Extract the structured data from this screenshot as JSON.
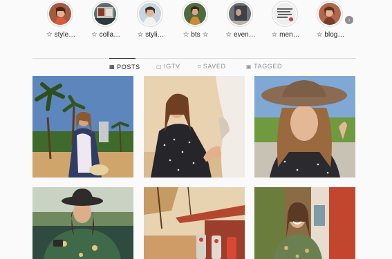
{
  "highlights": [
    {
      "label": "☆ style…",
      "icon": "highlight-style-thumbnail"
    },
    {
      "label": "☆ colla…",
      "icon": "highlight-collab-thumbnail"
    },
    {
      "label": "☆ styli…",
      "icon": "highlight-styling-thumbnail"
    },
    {
      "label": "☆ bts ☆",
      "icon": "highlight-bts-thumbnail"
    },
    {
      "label": "☆ even…",
      "icon": "highlight-events-thumbnail"
    },
    {
      "label": "☆ men…",
      "icon": "highlight-mentions-thumbnail"
    },
    {
      "label": "☆ blog…",
      "icon": "highlight-blog-thumbnail"
    }
  ],
  "highlights_next": "›",
  "tabs": [
    {
      "label": "POSTS",
      "icon": "grid-icon",
      "glyph": "▦"
    },
    {
      "label": "IGTV",
      "icon": "igtv-icon",
      "glyph": "▢"
    },
    {
      "label": "SAVED",
      "icon": "bookmark-icon",
      "glyph": "⌑"
    },
    {
      "label": "TAGGED",
      "icon": "tag-icon",
      "glyph": "▣"
    }
  ],
  "posts": [
    {
      "name": "post-beach-palms"
    },
    {
      "name": "post-horse-polka-dress"
    },
    {
      "name": "post-straw-hat-portrait"
    },
    {
      "name": "post-vintage-car-hat"
    },
    {
      "name": "post-gas-station"
    },
    {
      "name": "post-red-door-smile"
    }
  ],
  "colors": {
    "background": "#fafafa",
    "text": "#262626",
    "muted": "#8e8e8e",
    "divider": "#dbdbdb"
  }
}
